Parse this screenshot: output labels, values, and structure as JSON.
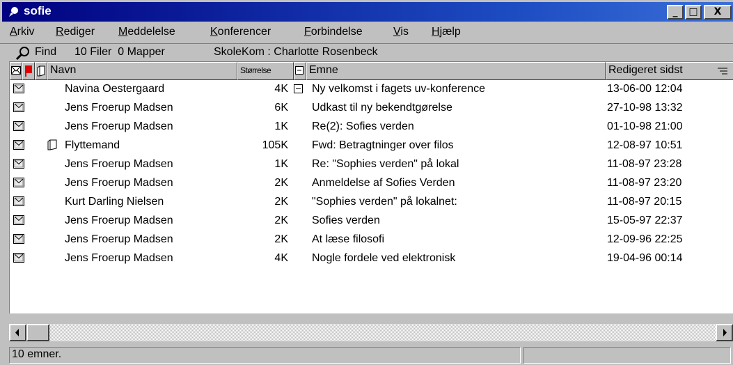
{
  "window": {
    "title": "sofie",
    "controls": {
      "minimize": "_",
      "maximize": "□",
      "close": "X"
    }
  },
  "menu": [
    {
      "label": "Arkiv"
    },
    {
      "label": "Rediger"
    },
    {
      "label": "Meddelelse"
    },
    {
      "label": "Konferencer"
    },
    {
      "label": "Forbindelse"
    },
    {
      "label": "Vis"
    },
    {
      "label": "Hjælp"
    }
  ],
  "toolbar": {
    "icon": "magnifier-icon",
    "find": "Find",
    "counts": "10 Filer  0 Mapper",
    "location": "SkoleKom : Charlotte Rosenbeck"
  },
  "columns": {
    "name": "Navn",
    "size": "Størrelse",
    "subject": "Emne",
    "edited": "Redigeret sidst"
  },
  "messages": [
    {
      "name": "Navina Oestergaard",
      "size": "4K",
      "subject": "Ny velkomst i fagets uv-konference",
      "edited": "13-06-00 12:04",
      "attachment": false,
      "thread": true
    },
    {
      "name": "Jens Froerup Madsen",
      "size": "6K",
      "subject": "Udkast til ny bekendtgørelse",
      "edited": "27-10-98 13:32",
      "attachment": false,
      "thread": false
    },
    {
      "name": "Jens Froerup Madsen",
      "size": "1K",
      "subject": "Re(2): Sofies verden",
      "edited": "01-10-98 21:00",
      "attachment": false,
      "thread": false
    },
    {
      "name": "Flyttemand",
      "size": "105K",
      "subject": "Fwd: Betragtninger over filos",
      "edited": "12-08-97 10:51",
      "attachment": true,
      "thread": false
    },
    {
      "name": "Jens Froerup Madsen",
      "size": "1K",
      "subject": "Re: \"Sophies verden\" på lokal",
      "edited": "11-08-97 23:28",
      "attachment": false,
      "thread": false
    },
    {
      "name": "Jens Froerup Madsen",
      "size": "2K",
      "subject": "Anmeldelse af Sofies Verden",
      "edited": "11-08-97 23:20",
      "attachment": false,
      "thread": false
    },
    {
      "name": "Kurt Darling Nielsen",
      "size": "2K",
      "subject": "\"Sophies verden\" på lokalnet:",
      "edited": "11-08-97 20:15",
      "attachment": false,
      "thread": false
    },
    {
      "name": "Jens Froerup Madsen",
      "size": "2K",
      "subject": "Sofies verden",
      "edited": "15-05-97 22:37",
      "attachment": false,
      "thread": false
    },
    {
      "name": "Jens Froerup Madsen",
      "size": "2K",
      "subject": "At læse filosofi",
      "edited": "12-09-96 22:25",
      "attachment": false,
      "thread": false
    },
    {
      "name": "Jens Froerup Madsen",
      "size": "4K",
      "subject": "Nogle fordele ved elektronisk",
      "edited": "19-04-96 00:14",
      "attachment": false,
      "thread": false
    }
  ],
  "status": {
    "text": "10 emner."
  },
  "colors": {
    "titlebar_start": "#000080",
    "titlebar_end": "#3a6fd8",
    "flag_red": "#e00000",
    "chrome": "#c0c0c0"
  }
}
